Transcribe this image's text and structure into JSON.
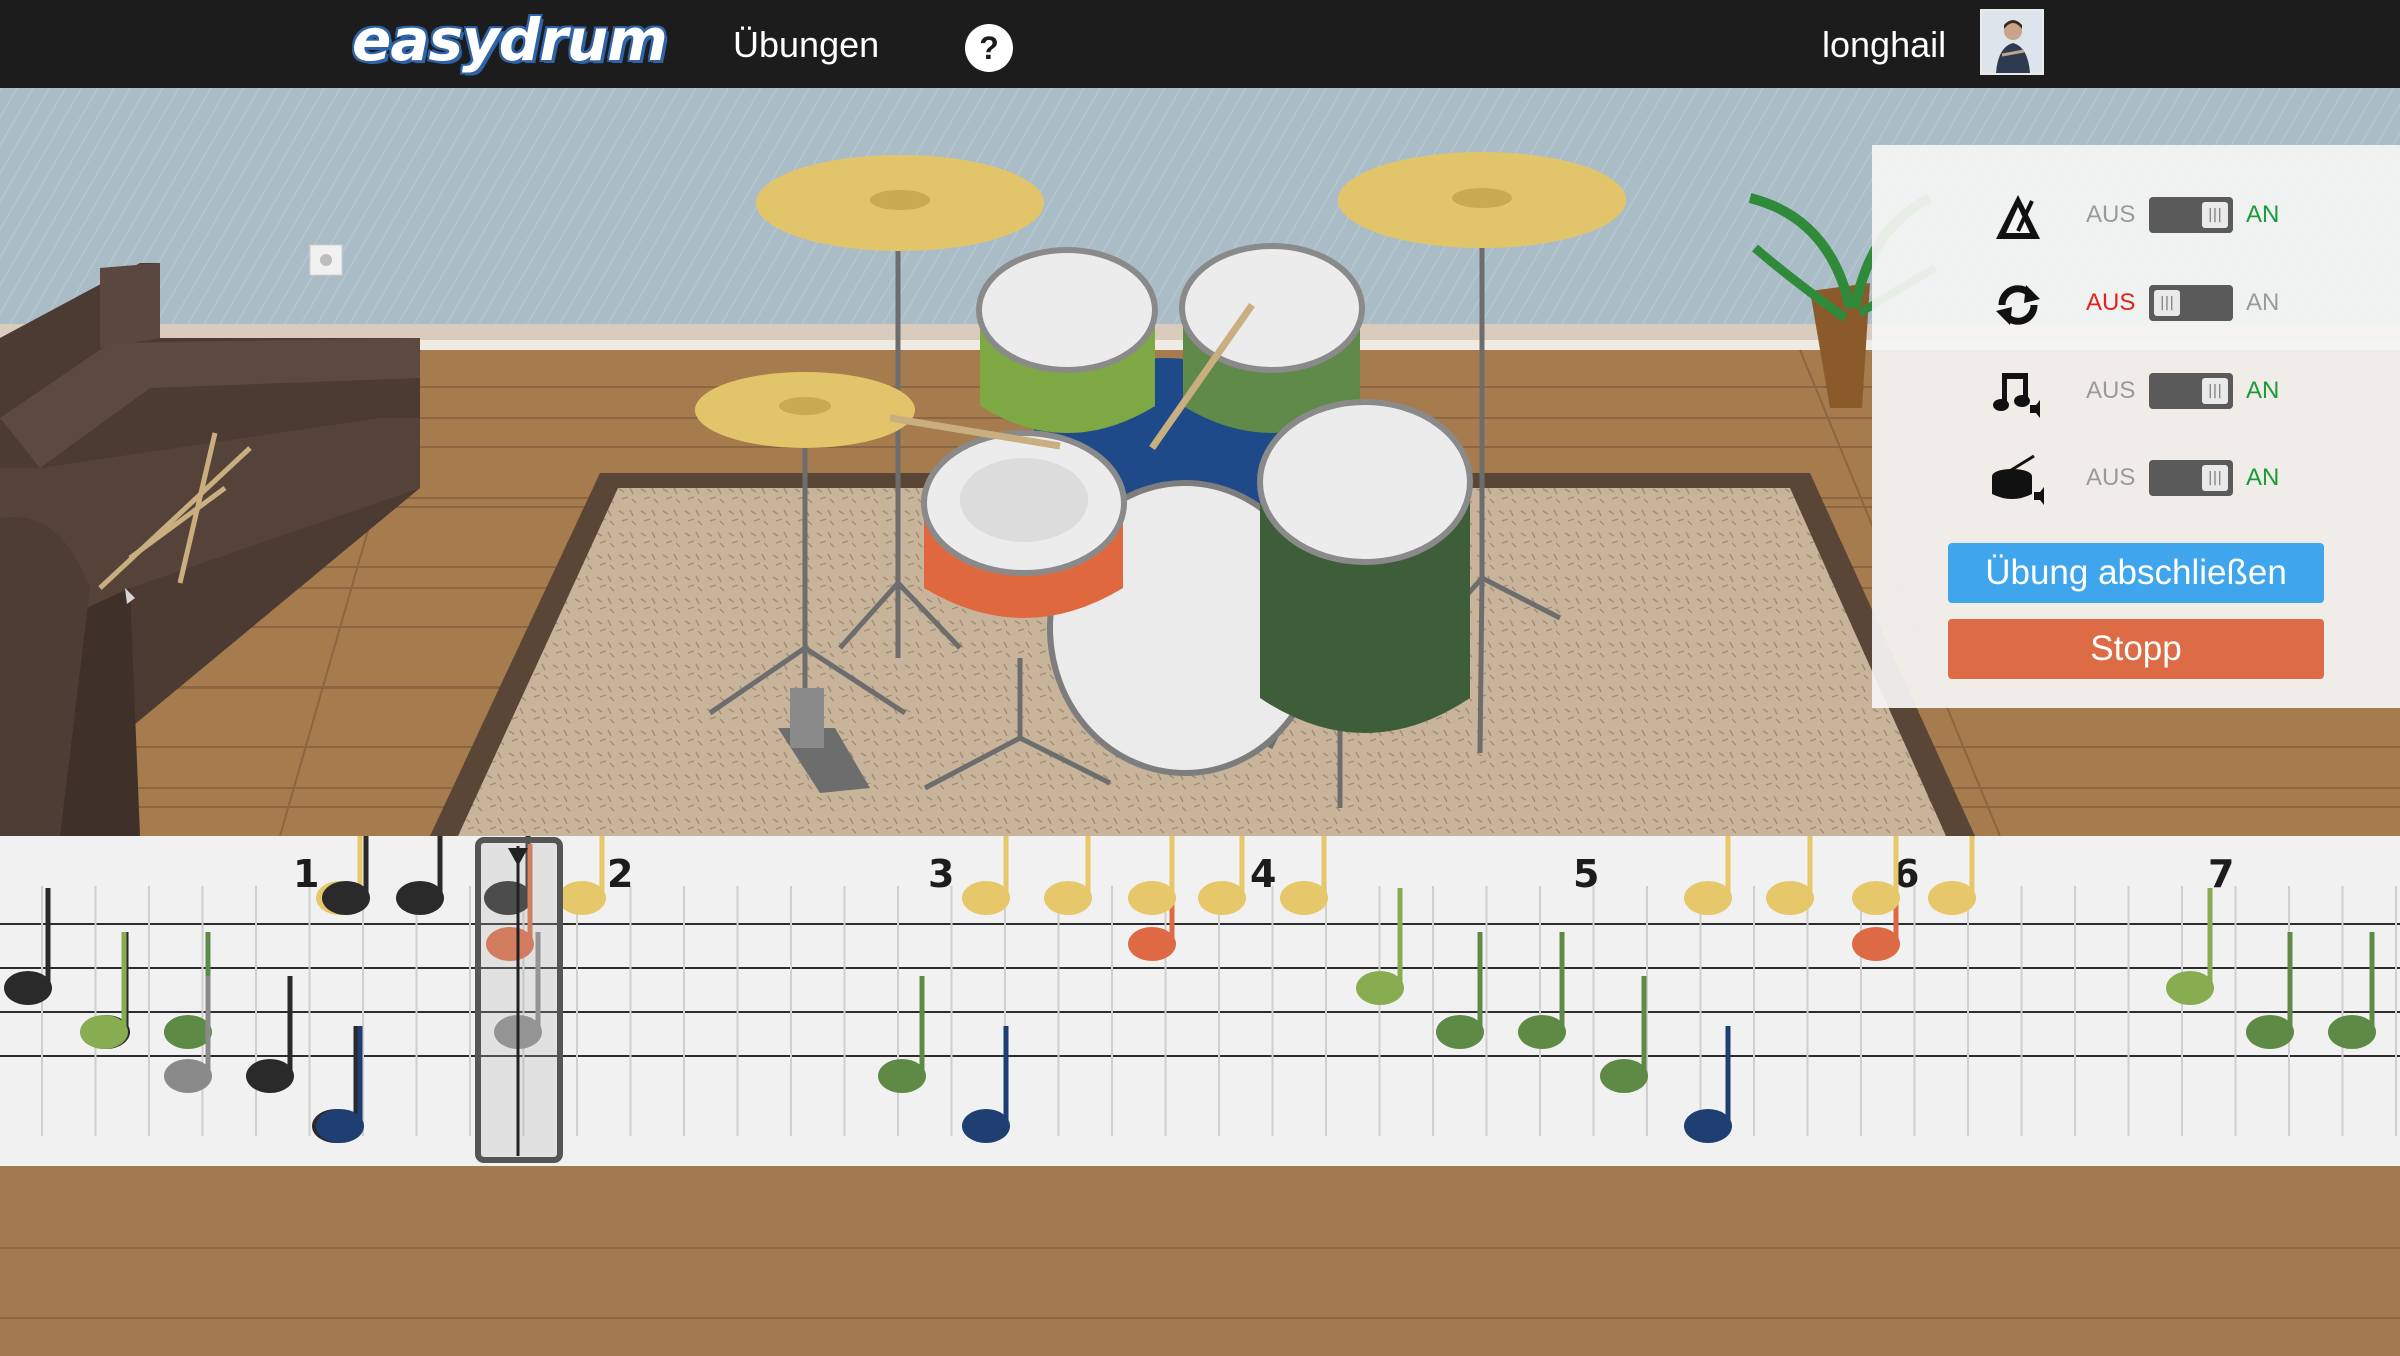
{
  "header": {
    "logo": "easydrum",
    "nav_exercises": "Übungen",
    "help": "?",
    "username": "longhail"
  },
  "settings": {
    "rows": [
      {
        "icon": "metronome-icon",
        "off": "AUS",
        "on": "AN",
        "state": "on"
      },
      {
        "icon": "loop-icon",
        "off": "AUS",
        "on": "AN",
        "state": "off"
      },
      {
        "icon": "music-sound-icon",
        "off": "AUS",
        "on": "AN",
        "state": "on"
      },
      {
        "icon": "drum-sound-icon",
        "off": "AUS",
        "on": "AN",
        "state": "on"
      }
    ],
    "finish_button": "Übung abschließen",
    "stop_button": "Stopp"
  },
  "notation": {
    "measures": [
      "1",
      "2",
      "3",
      "4",
      "5",
      "6",
      "7"
    ]
  },
  "colors": {
    "topbar": "#1c1c1c",
    "wall": "#a9bcc6",
    "floor": "#a37a4f",
    "rug": "#c7b49a",
    "cymbal": "#e2c56b",
    "tom_green": "#7ea843",
    "tom_green_dark": "#5f8a4a",
    "floor_tom": "#3e5e3a",
    "snare": "#e0683f",
    "bass_front": "#ececec",
    "note_black": "#2a2a2a",
    "note_yellow": "#e6c86a",
    "note_orange": "#dd6a44",
    "note_green": "#5e8a46",
    "note_light_green": "#88ad50",
    "note_navy": "#1f3f73",
    "note_gray": "#8a8a8a",
    "finish_blue": "#3fa6ee",
    "stop_orange": "#dc6b46"
  }
}
